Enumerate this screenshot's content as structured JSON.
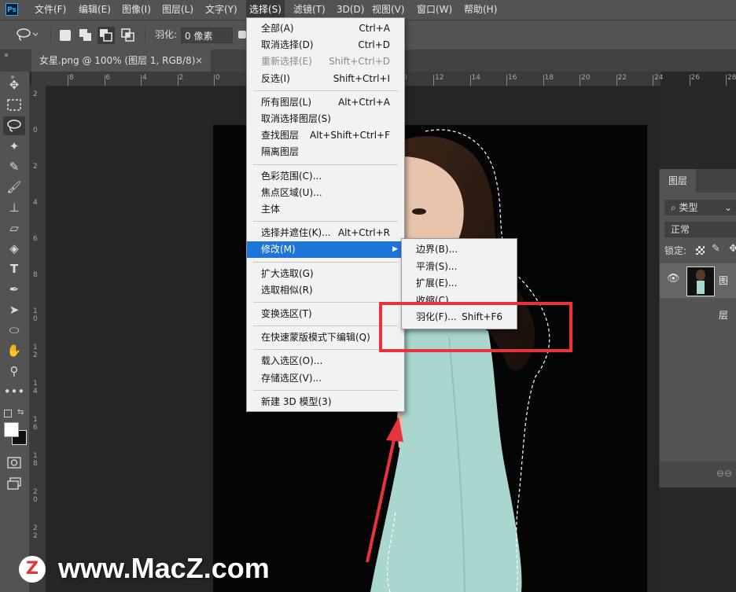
{
  "app": {
    "logo": "Ps"
  },
  "menubar": {
    "items": [
      "文件(F)",
      "编辑(E)",
      "图像(I)",
      "图层(L)",
      "文字(Y)",
      "选择(S)",
      "滤镜(T)",
      "3D(D)",
      "视图(V)",
      "窗口(W)",
      "帮助(H)"
    ],
    "active_index": 5
  },
  "options": {
    "feather_label": "羽化:",
    "feather_value": "0 像素"
  },
  "document": {
    "tab_title": "女星.png @ 100% (图层 1, RGB/8)",
    "close_glyph": "×"
  },
  "rulers": {
    "top": [
      "8",
      "6",
      "4",
      "2",
      "0",
      "2",
      "4",
      "6",
      "8",
      "10",
      "12",
      "14",
      "16",
      "18",
      "20",
      "22",
      "24",
      "26",
      "28"
    ],
    "left": [
      "2",
      "0",
      "2",
      "4",
      "6",
      "8",
      "1\n0",
      "1\n2",
      "1\n4",
      "1\n6",
      "1\n8",
      "2\n0",
      "2\n2",
      "2\n4"
    ]
  },
  "select_menu": {
    "items": [
      {
        "label": "全部(A)",
        "shortcut": "Ctrl+A"
      },
      {
        "label": "取消选择(D)",
        "shortcut": "Ctrl+D"
      },
      {
        "label": "重新选择(E)",
        "shortcut": "Shift+Ctrl+D",
        "disabled": true
      },
      {
        "label": "反选(I)",
        "shortcut": "Shift+Ctrl+I"
      },
      {
        "separator": true
      },
      {
        "label": "所有图层(L)",
        "shortcut": "Alt+Ctrl+A"
      },
      {
        "label": "取消选择图层(S)",
        "shortcut": ""
      },
      {
        "label": "查找图层",
        "shortcut": "Alt+Shift+Ctrl+F"
      },
      {
        "label": "隔离图层",
        "shortcut": ""
      },
      {
        "separator": true
      },
      {
        "label": "色彩范围(C)...",
        "shortcut": ""
      },
      {
        "label": "焦点区域(U)...",
        "shortcut": ""
      },
      {
        "label": "主体",
        "shortcut": ""
      },
      {
        "separator": true
      },
      {
        "label": "选择并遮住(K)...",
        "shortcut": "Alt+Ctrl+R"
      },
      {
        "label": "修改(M)",
        "shortcut": "",
        "submenu": true,
        "highlighted": true
      },
      {
        "separator": true
      },
      {
        "label": "扩大选取(G)",
        "shortcut": ""
      },
      {
        "label": "选取相似(R)",
        "shortcut": ""
      },
      {
        "separator": true
      },
      {
        "label": "变换选区(T)",
        "shortcut": ""
      },
      {
        "separator": true
      },
      {
        "label": "在快速蒙版模式下编辑(Q)",
        "shortcut": ""
      },
      {
        "separator": true
      },
      {
        "label": "载入选区(O)...",
        "shortcut": ""
      },
      {
        "label": "存储选区(V)...",
        "shortcut": ""
      },
      {
        "separator": true
      },
      {
        "label": "新建 3D 模型(3)",
        "shortcut": ""
      }
    ]
  },
  "modify_submenu": {
    "items": [
      {
        "label": "边界(B)...",
        "shortcut": ""
      },
      {
        "label": "平滑(S)...",
        "shortcut": ""
      },
      {
        "label": "扩展(E)...",
        "shortcut": ""
      },
      {
        "label": "收缩(C)...",
        "shortcut": ""
      },
      {
        "label": "羽化(F)...",
        "shortcut": "Shift+F6"
      }
    ]
  },
  "layers_panel": {
    "tab": "图层",
    "filter_label": "类型",
    "blend_mode": "正常",
    "lock_label": "锁定:",
    "layer_name": "图层"
  },
  "watermark": {
    "letter": "Z",
    "text": "www.MacZ.com"
  },
  "colors": {
    "highlight": "#1f74d8",
    "annotation_red": "#e8333c",
    "dress": "#a9d6cf"
  }
}
